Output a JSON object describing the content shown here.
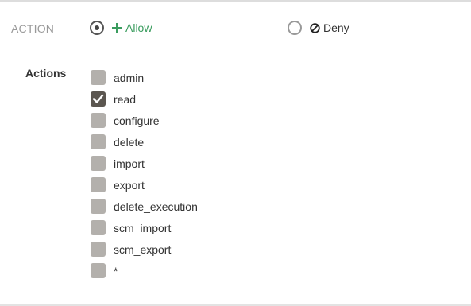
{
  "action": {
    "label": "ACTION",
    "options": [
      {
        "label": "Allow",
        "selected": true,
        "icon": "plus-icon",
        "color": "#3a9c5e"
      },
      {
        "label": "Deny",
        "selected": false,
        "icon": "ban-icon",
        "color": "#333333"
      }
    ]
  },
  "actions": {
    "label": "Actions",
    "items": [
      {
        "label": "admin",
        "checked": false
      },
      {
        "label": "read",
        "checked": true
      },
      {
        "label": "configure",
        "checked": false
      },
      {
        "label": "delete",
        "checked": false
      },
      {
        "label": "import",
        "checked": false
      },
      {
        "label": "export",
        "checked": false
      },
      {
        "label": "delete_execution",
        "checked": false
      },
      {
        "label": "scm_import",
        "checked": false
      },
      {
        "label": "scm_export",
        "checked": false
      },
      {
        "label": "*",
        "checked": false
      }
    ]
  },
  "colors": {
    "checkbox_unchecked": "#b3b0ac",
    "checkbox_checked": "#5b5650",
    "allow_green": "#3a9c5e"
  }
}
